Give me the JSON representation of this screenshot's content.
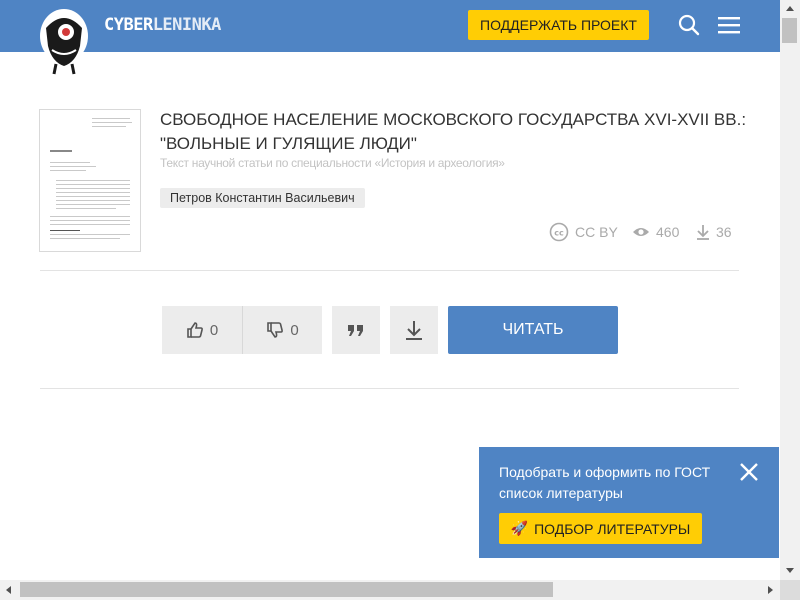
{
  "header": {
    "logo_cyber": "CYBER",
    "logo_leninka": "LENINKA",
    "support_label": "ПОДДЕРЖАТЬ ПРОЕКТ"
  },
  "article": {
    "title": "Свободное население Московского государства XVI-XVII вв.: \"вольные и гулящие люди\"",
    "subtitle": "Текст научной статьи по специальности «История и археология»",
    "author": "Петров Константин Васильевич",
    "license": "CC BY",
    "views": "460",
    "downloads": "36"
  },
  "actions": {
    "likes": "0",
    "dislikes": "0",
    "read_label": "ЧИТАТЬ"
  },
  "promo": {
    "text": "Подобрать и оформить по ГОСТ список литературы",
    "button_label": "ПОДБОР ЛИТЕРАТУРЫ",
    "button_icon": "🚀"
  },
  "colors": {
    "brand_blue": "#4f84c4",
    "accent_yellow": "#ffcd05"
  }
}
